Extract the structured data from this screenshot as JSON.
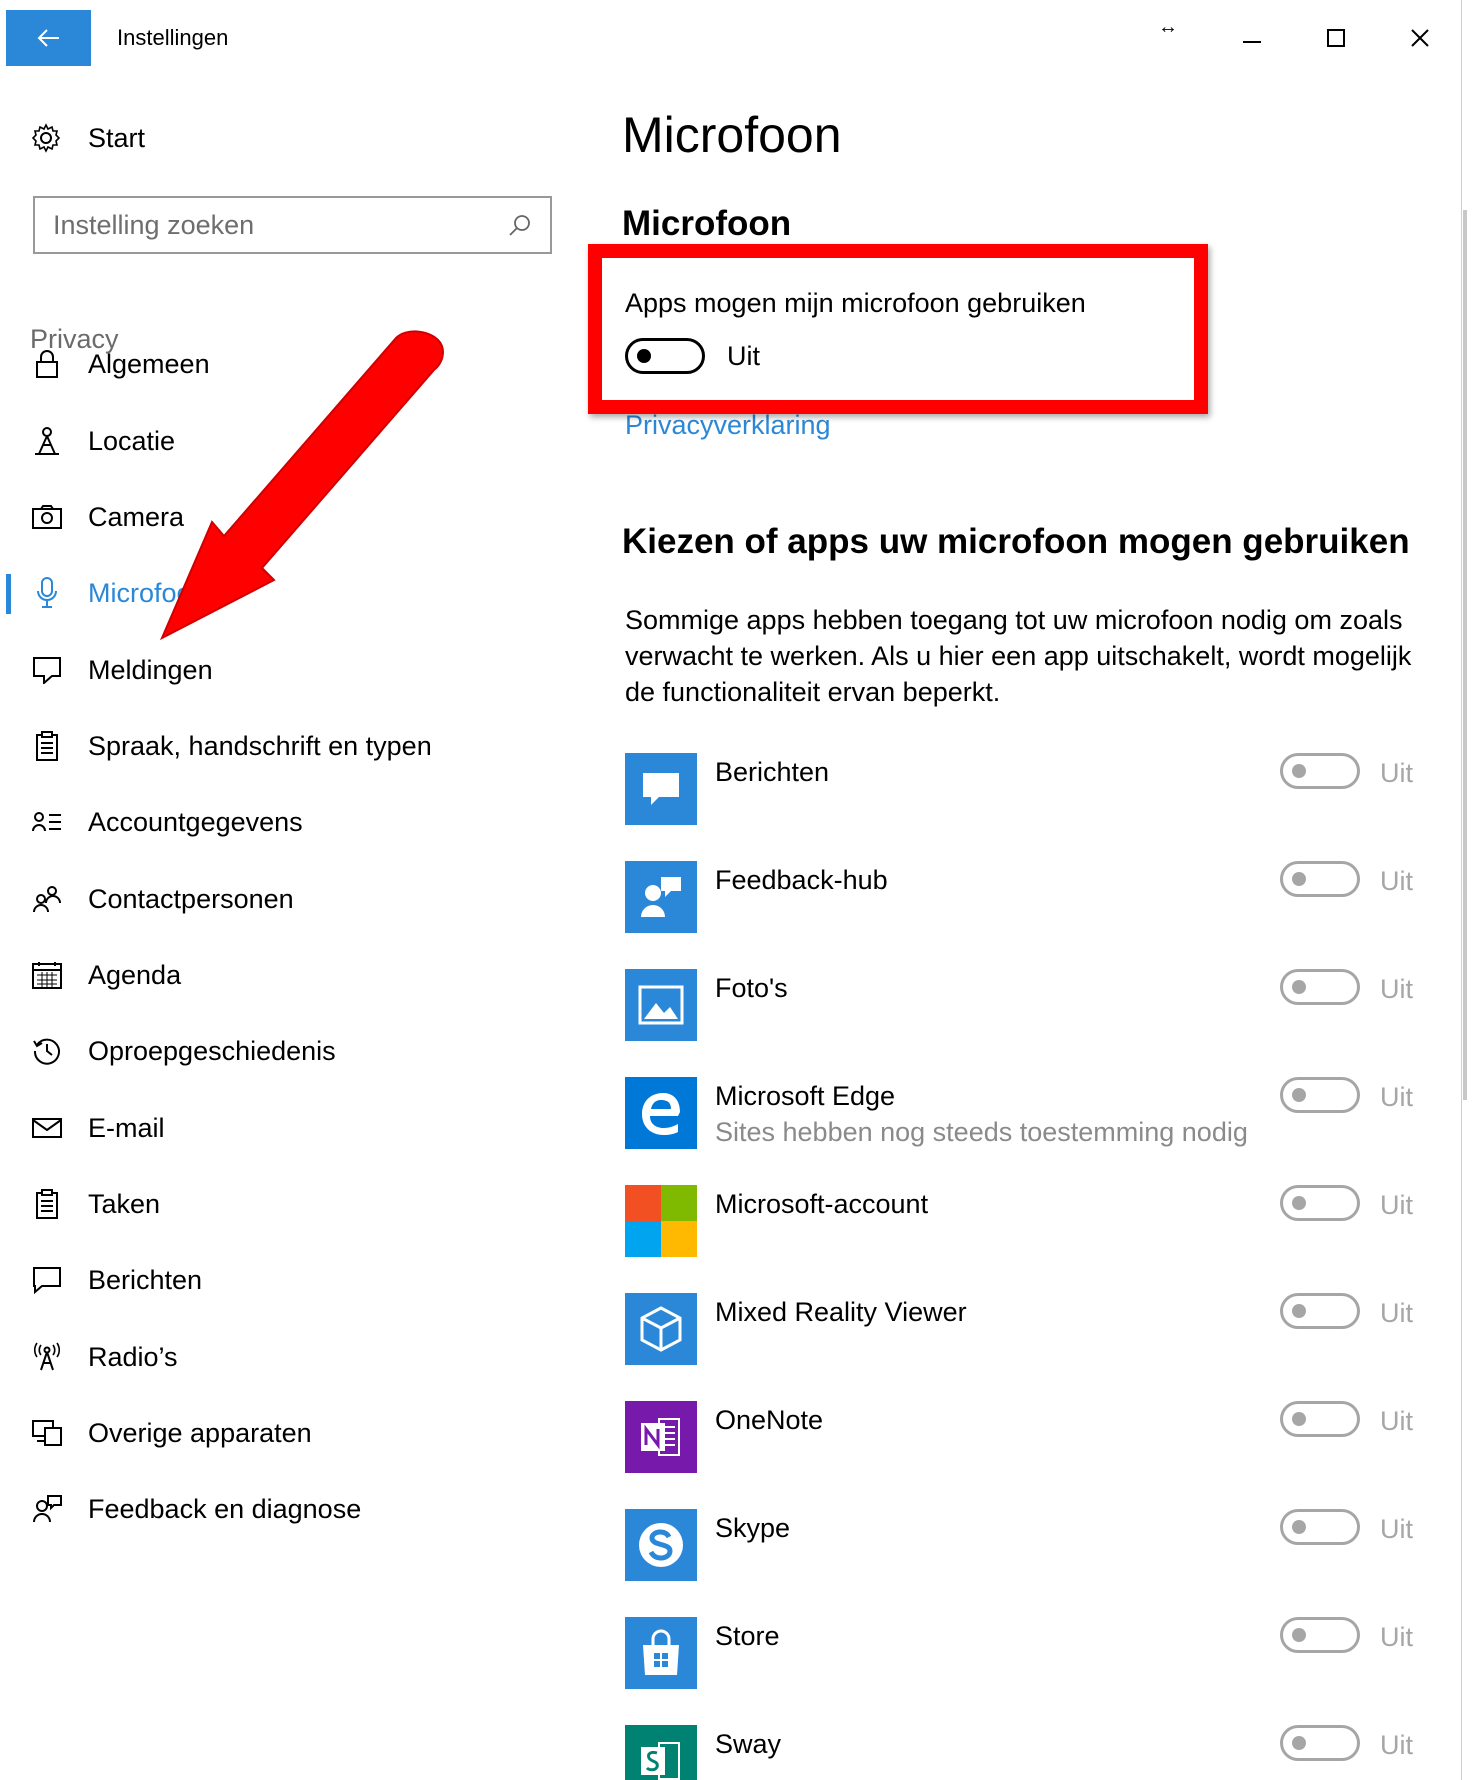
{
  "window": {
    "title": "Instellingen",
    "back_icon": "arrow-left-icon",
    "resize_glyph": "↔"
  },
  "sidebar": {
    "start_label": "Start",
    "search_placeholder": "Instelling zoeken",
    "section_label": "Privacy",
    "items": [
      {
        "label": "Algemeen",
        "icon": "lock-icon"
      },
      {
        "label": "Locatie",
        "icon": "location-person-icon"
      },
      {
        "label": "Camera",
        "icon": "camera-icon"
      },
      {
        "label": "Microfoon",
        "icon": "microphone-icon",
        "active": true
      },
      {
        "label": "Meldingen",
        "icon": "notification-icon"
      },
      {
        "label": "Spraak, handschrift en typen",
        "icon": "clipboard-icon"
      },
      {
        "label": "Accountgegevens",
        "icon": "account-info-icon"
      },
      {
        "label": "Contactpersonen",
        "icon": "contacts-icon"
      },
      {
        "label": "Agenda",
        "icon": "calendar-icon"
      },
      {
        "label": "Oproepgeschiedenis",
        "icon": "history-icon"
      },
      {
        "label": "E-mail",
        "icon": "mail-icon"
      },
      {
        "label": "Taken",
        "icon": "tasks-icon"
      },
      {
        "label": "Berichten",
        "icon": "message-icon"
      },
      {
        "label": "Radio’s",
        "icon": "radio-icon"
      },
      {
        "label": "Overige apparaten",
        "icon": "devices-icon"
      },
      {
        "label": "Feedback en diagnose",
        "icon": "feedback-icon"
      }
    ]
  },
  "main": {
    "page_title": "Microfoon",
    "sub_title": "Microfoon",
    "master_setting_label": "Apps mogen mijn microfoon gebruiken",
    "master_toggle_state": "Uit",
    "privacy_link": "Privacyverklaring",
    "section_title": "Kiezen of apps uw microfoon mogen gebruiken",
    "description": "Sommige apps hebben toegang tot uw microfoon nodig om zoals verwacht te werken. Als u hier een app uitschakelt, wordt mogelijk de functionaliteit ervan beperkt.",
    "apps": [
      {
        "name": "Berichten",
        "status": "Uit",
        "icon": "messaging-app-icon",
        "color": "#2b88d8"
      },
      {
        "name": "Feedback-hub",
        "status": "Uit",
        "icon": "feedback-hub-icon",
        "color": "#2b88d8"
      },
      {
        "name": "Foto's",
        "status": "Uit",
        "icon": "photos-icon",
        "color": "#2b88d8"
      },
      {
        "name": "Microsoft Edge",
        "sub": "Sites hebben nog steeds toestemming nodig",
        "status": "Uit",
        "icon": "edge-icon",
        "color": "#0078d7"
      },
      {
        "name": "Microsoft-account",
        "status": "Uit",
        "icon": "microsoft-logo-icon",
        "color": "#ffffff"
      },
      {
        "name": "Mixed Reality Viewer",
        "status": "Uit",
        "icon": "cube-icon",
        "color": "#2b88d8"
      },
      {
        "name": "OneNote",
        "status": "Uit",
        "icon": "onenote-icon",
        "color": "#7719aa"
      },
      {
        "name": "Skype",
        "status": "Uit",
        "icon": "skype-icon",
        "color": "#2b88d8"
      },
      {
        "name": "Store",
        "status": "Uit",
        "icon": "store-icon",
        "color": "#2b88d8"
      },
      {
        "name": "Sway",
        "status": "Uit",
        "icon": "sway-icon",
        "color": "#008272"
      }
    ]
  },
  "colors": {
    "accent": "#2b88d8",
    "highlight_box": "#ff0000",
    "arrow": "#ff0000"
  }
}
